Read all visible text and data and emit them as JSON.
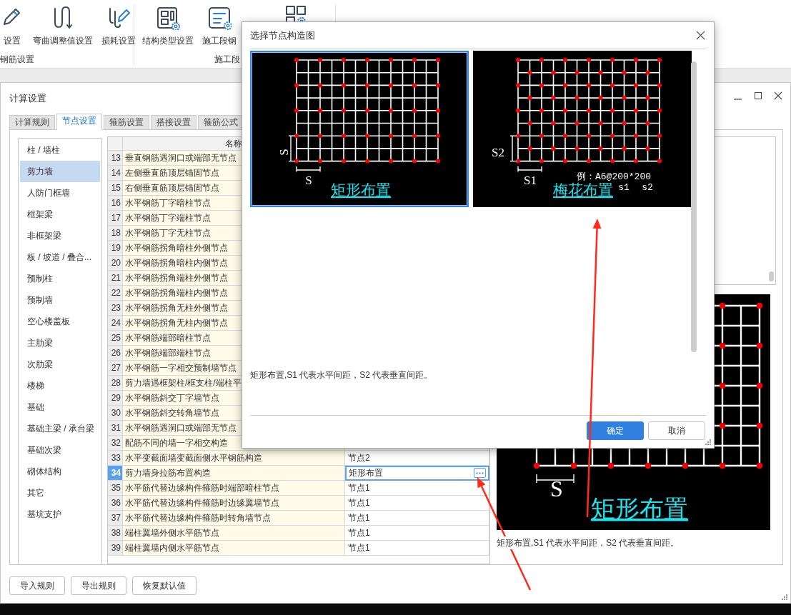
{
  "ribbon": {
    "groups": [
      {
        "label": "钢筋设置",
        "items": [
          {
            "label": "设置"
          },
          {
            "label": "弯曲调整值设置"
          },
          {
            "label": "损耗设置"
          }
        ]
      },
      {
        "label": "施工段",
        "items": [
          {
            "label": "结构类型设置"
          },
          {
            "label": "施工段钢"
          }
        ]
      }
    ]
  },
  "settings_window": {
    "title": "计算设置",
    "tabs": [
      {
        "label": "计算规则",
        "selected": false
      },
      {
        "label": "节点设置",
        "selected": true
      },
      {
        "label": "箍筋设置",
        "selected": false
      },
      {
        "label": "搭接设置",
        "selected": false
      },
      {
        "label": "箍筋公式",
        "selected": false
      }
    ],
    "categories": [
      {
        "label": "柱 / 墙柱",
        "selected": false
      },
      {
        "label": "剪力墙",
        "selected": true
      },
      {
        "label": "人防门框墙",
        "selected": false
      },
      {
        "label": "框架梁",
        "selected": false
      },
      {
        "label": "非框架梁",
        "selected": false
      },
      {
        "label": "板 / 坡道 / 叠合...",
        "selected": false
      },
      {
        "label": "预制柱",
        "selected": false
      },
      {
        "label": "预制墙",
        "selected": false
      },
      {
        "label": "空心楼盖板",
        "selected": false
      },
      {
        "label": "主肋梁",
        "selected": false
      },
      {
        "label": "次肋梁",
        "selected": false
      },
      {
        "label": "楼梯",
        "selected": false
      },
      {
        "label": "基础",
        "selected": false
      },
      {
        "label": "基础主梁 / 承台梁",
        "selected": false
      },
      {
        "label": "基础次梁",
        "selected": false
      },
      {
        "label": "砌体结构",
        "selected": false
      },
      {
        "label": "其它",
        "selected": false
      },
      {
        "label": "基坑支护",
        "selected": false
      }
    ],
    "table": {
      "columns": [
        "名称"
      ],
      "rows": [
        {
          "index": "13",
          "name": "垂直钢筋遇洞口或端部无节点",
          "selected": false
        },
        {
          "index": "14",
          "name": "左侧垂直筋顶层锚固节点",
          "selected": false
        },
        {
          "index": "15",
          "name": "右侧垂直筋顶层锚固节点",
          "selected": false
        },
        {
          "index": "16",
          "name": "水平钢筋丁字暗柱节点",
          "selected": false
        },
        {
          "index": "17",
          "name": "水平钢筋丁字端柱节点",
          "selected": false
        },
        {
          "index": "18",
          "name": "水平钢筋丁字无柱节点",
          "selected": false
        },
        {
          "index": "19",
          "name": "水平钢筋拐角暗柱外侧节点",
          "selected": false
        },
        {
          "index": "20",
          "name": "水平钢筋拐角暗柱内侧节点",
          "selected": false
        },
        {
          "index": "21",
          "name": "水平钢筋拐角端柱外侧节点",
          "selected": false
        },
        {
          "index": "22",
          "name": "水平钢筋拐角端柱内侧节点",
          "selected": false
        },
        {
          "index": "23",
          "name": "水平钢筋拐角无柱外侧节点",
          "selected": false
        },
        {
          "index": "24",
          "name": "水平钢筋拐角无柱内侧节点",
          "selected": false
        },
        {
          "index": "25",
          "name": "水平钢筋端部暗柱节点",
          "selected": false
        },
        {
          "index": "26",
          "name": "水平钢筋端部端柱节点",
          "selected": false
        },
        {
          "index": "27",
          "name": "水平钢筋一字相交预制墙节点",
          "selected": false
        },
        {
          "index": "28",
          "name": "剪力墙遇框架柱/框支柱/端柱平",
          "selected": false
        },
        {
          "index": "29",
          "name": "水平钢筋斜交丁字墙节点",
          "selected": false
        },
        {
          "index": "30",
          "name": "水平钢筋斜交转角墙节点",
          "selected": false
        },
        {
          "index": "31",
          "name": "水平钢筋遇洞口或端部无节点",
          "selected": false
        },
        {
          "index": "32",
          "name": "配筋不同的墙一字相交构造",
          "selected": false
        },
        {
          "index": "33",
          "name": "水平变截面墙变截面侧水平钢筋构造",
          "value": "节点2",
          "selected": false
        },
        {
          "index": "34",
          "name": "剪力墙身拉筋布置构造",
          "value": "矩形布置",
          "selected": true
        },
        {
          "index": "35",
          "name": "水平筋代替边缘构件箍筋时端部暗柱节点",
          "value": "节点1",
          "selected": false
        },
        {
          "index": "36",
          "name": "水平筋代替边缘构件箍筋时边缘翼墙节点",
          "value": "节点1",
          "selected": false
        },
        {
          "index": "37",
          "name": "水平筋代替边缘构件箍筋时转角墙节点",
          "value": "节点1",
          "selected": false
        },
        {
          "index": "38",
          "name": "端柱翼墙外侧水平筋节点",
          "value": "节点1",
          "selected": false
        },
        {
          "index": "39",
          "name": "端柱翼墙内侧水平筋节点",
          "value": "节点1",
          "selected": false
        }
      ]
    },
    "preview": {
      "dimension": "S",
      "caption": "矩形布置",
      "description": "矩形布置,S1 代表水平间距，S2 代表垂直间距。"
    },
    "buttons": [
      "导入规则",
      "导出规则",
      "恢复默认值"
    ]
  },
  "dialog": {
    "title": "选择节点构造图",
    "options": [
      {
        "kind": "rectangular",
        "selected": true,
        "dim_vertical": "S",
        "dim_horizontal": "S",
        "caption": "矩形布置"
      },
      {
        "kind": "quincunx",
        "selected": false,
        "dim_vertical": "S2",
        "dim_horizontal": "S1",
        "example": "例：A6@200*200",
        "caption": "梅花布置",
        "example_marks": [
          "s1",
          "s2"
        ]
      }
    ],
    "description": "矩形布置,S1 代表水平间距，S2 代表垂直间距。",
    "buttons": [
      {
        "label": "确定",
        "kind": "primary"
      },
      {
        "label": "取消",
        "kind": "secondary"
      }
    ]
  }
}
